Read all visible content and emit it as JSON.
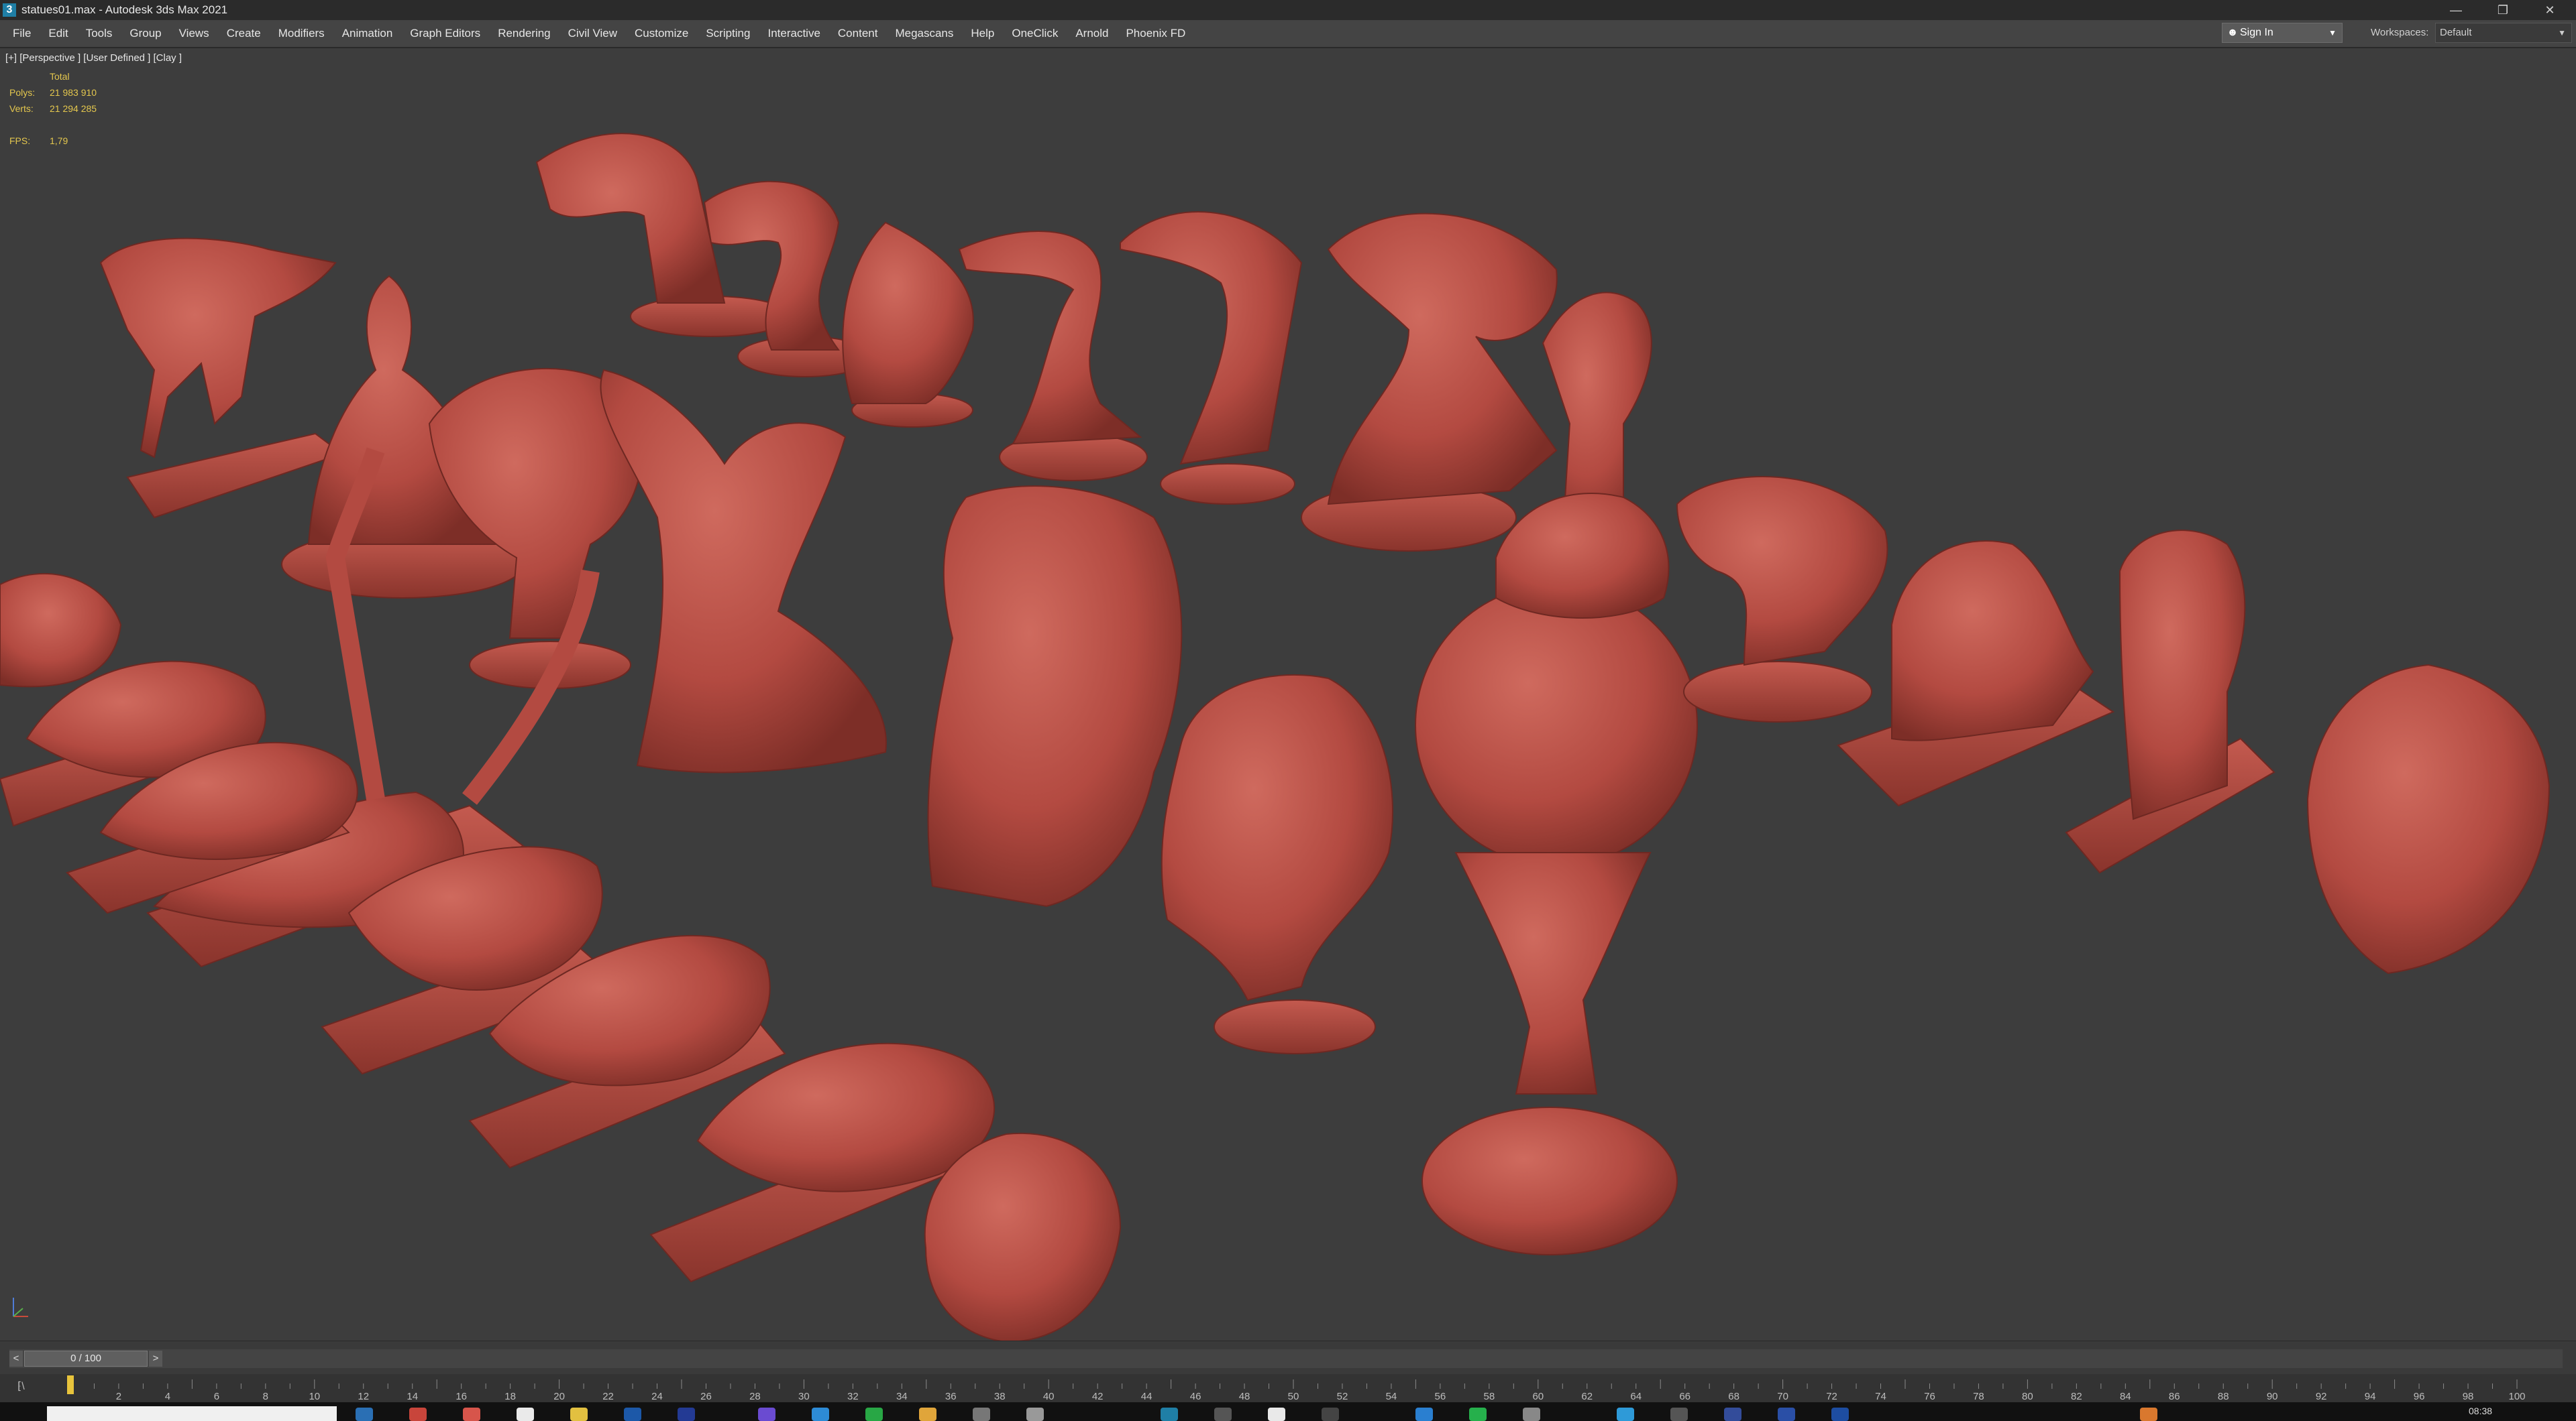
{
  "window": {
    "title": "statues01.max - Autodesk 3ds Max 2021",
    "app_icon": "3"
  },
  "menu": [
    "File",
    "Edit",
    "Tools",
    "Group",
    "Views",
    "Create",
    "Modifiers",
    "Animation",
    "Graph Editors",
    "Rendering",
    "Civil View",
    "Customize",
    "Scripting",
    "Interactive",
    "Content",
    "Megascans",
    "Help",
    "OneClick",
    "Arnold",
    "Phoenix FD"
  ],
  "account": {
    "sign_in": "Sign In"
  },
  "workspaces": {
    "label": "Workspaces:",
    "value": "Default"
  },
  "viewport": {
    "label": "[+] [Perspective ] [User Defined ] [Clay ]",
    "stats": {
      "header": "Total",
      "polys_label": "Polys:",
      "polys": "21 983 910",
      "verts_label": "Verts:",
      "verts": "21 294 285",
      "fps_label": "FPS:",
      "fps": "1,79"
    }
  },
  "time_slider": {
    "position": "0 / 100",
    "prev": "<",
    "next": ">"
  },
  "track_bar": {
    "ticks": [
      "2",
      "4",
      "6",
      "8",
      "10",
      "12",
      "14",
      "16",
      "18",
      "20",
      "22",
      "24",
      "26",
      "28",
      "30",
      "32",
      "34",
      "36",
      "38",
      "40",
      "42",
      "44",
      "46",
      "48",
      "50",
      "52",
      "54",
      "56",
      "58",
      "60",
      "62",
      "64",
      "66",
      "68",
      "70",
      "72",
      "74",
      "76",
      "78",
      "80",
      "82",
      "84",
      "86",
      "88",
      "90",
      "92",
      "94",
      "96",
      "98",
      "100"
    ],
    "key_icon": "key-icon"
  },
  "taskbar": {
    "clock": "08:38"
  },
  "colors": {
    "statue": "#b34a41",
    "statue_dark": "#7d2e27",
    "statue_light": "#cf6a5e",
    "background": "#3d3d3d",
    "stats_text": "#e4c74e",
    "accent": "#1f7fa6"
  }
}
